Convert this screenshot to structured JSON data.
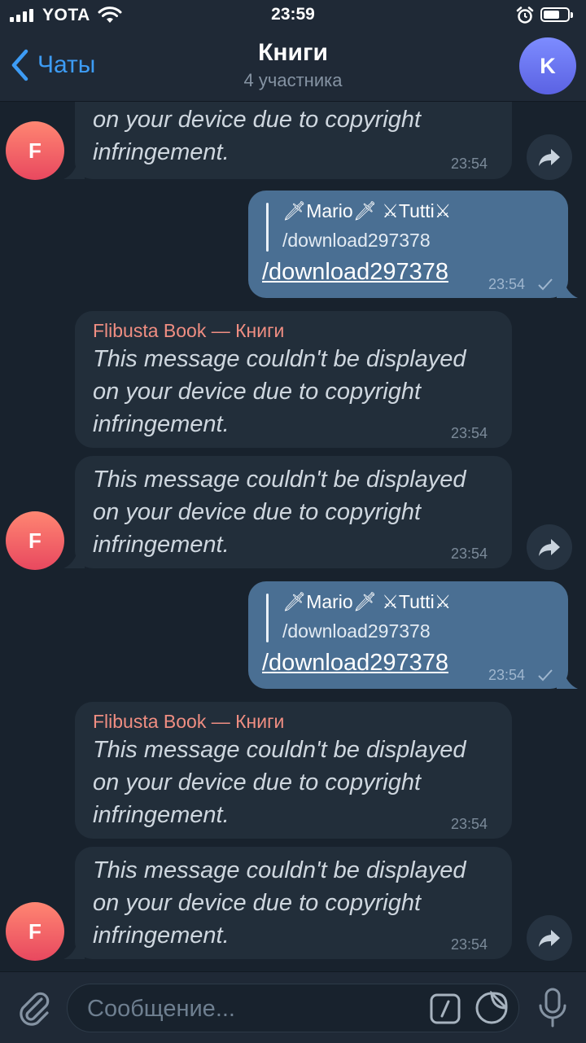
{
  "status_bar": {
    "carrier": "YOTA",
    "time": "23:59"
  },
  "header": {
    "back_label": "Чаты",
    "title": "Книги",
    "subtitle": "4 участника",
    "avatar_letter": "K"
  },
  "messages": [
    {
      "lines": [
        "on your device due to copyright",
        "infringement."
      ],
      "time": "23:54"
    },
    {
      "reply_name": "🗡Mario🗡 ⚔Tutti⚔",
      "reply_text": "/download297378",
      "link": "/download297378",
      "time": "23:54"
    },
    {
      "sender": "Flibusta Book — Книги",
      "lines": [
        "This message couldn't be displayed",
        "on your device due to copyright",
        "infringement."
      ],
      "time": "23:54"
    },
    {
      "lines": [
        "This message couldn't be displayed",
        "on your device due to copyright",
        "infringement."
      ],
      "time": "23:54"
    },
    {
      "reply_name": "🗡Mario🗡 ⚔Tutti⚔",
      "reply_text": "/download297378",
      "link": "/download297378",
      "time": "23:54"
    },
    {
      "sender": "Flibusta Book — Книги",
      "lines": [
        "This message couldn't be displayed",
        "on your device due to copyright",
        "infringement."
      ],
      "time": "23:54"
    },
    {
      "lines": [
        "This message couldn't be displayed",
        "on your device due to copyright",
        "infringement."
      ],
      "time": "23:54"
    }
  ],
  "sender_avatar_letter": "F",
  "composer": {
    "placeholder": "Сообщение..."
  }
}
